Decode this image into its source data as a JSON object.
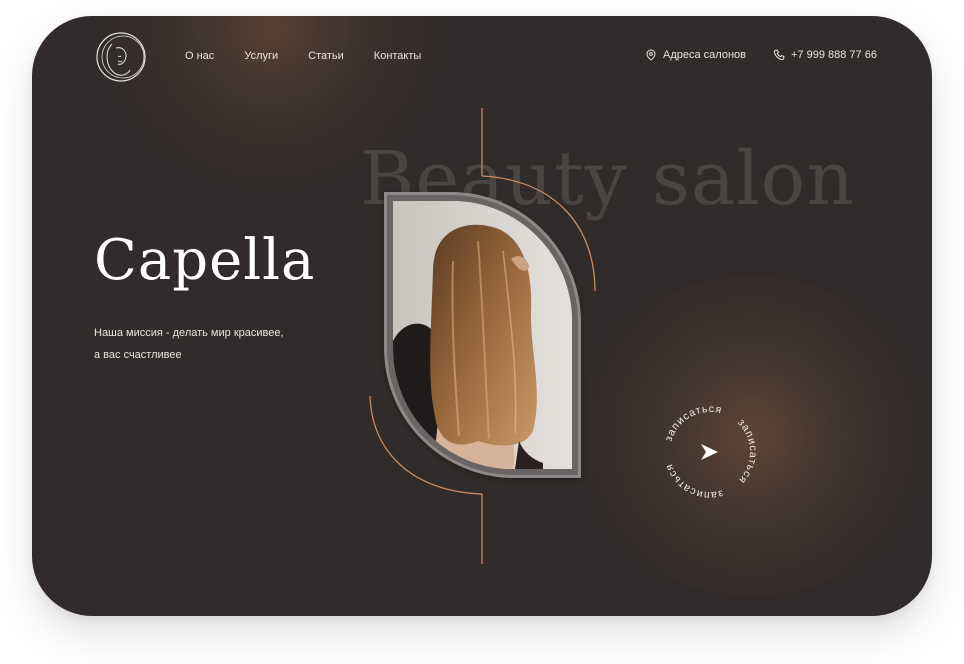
{
  "nav": {
    "items": [
      {
        "label": "О нас"
      },
      {
        "label": "Услуги"
      },
      {
        "label": "Статьи"
      },
      {
        "label": "Контакты"
      }
    ]
  },
  "header": {
    "address_label": "Адреса салонов",
    "phone": "+7 999 888 77 66",
    "icons": {
      "address": "location-pin-icon",
      "phone": "phone-icon"
    }
  },
  "hero": {
    "background_title": "Beauty salon",
    "brand": "Capella",
    "mission_line1": "Наша миссия - делать мир красивее,",
    "mission_line2": "а вас счастливее"
  },
  "booking": {
    "label": "записаться"
  },
  "colors": {
    "background": "#312c2b",
    "accent": "#c98a62",
    "text": "#e9e4df"
  }
}
